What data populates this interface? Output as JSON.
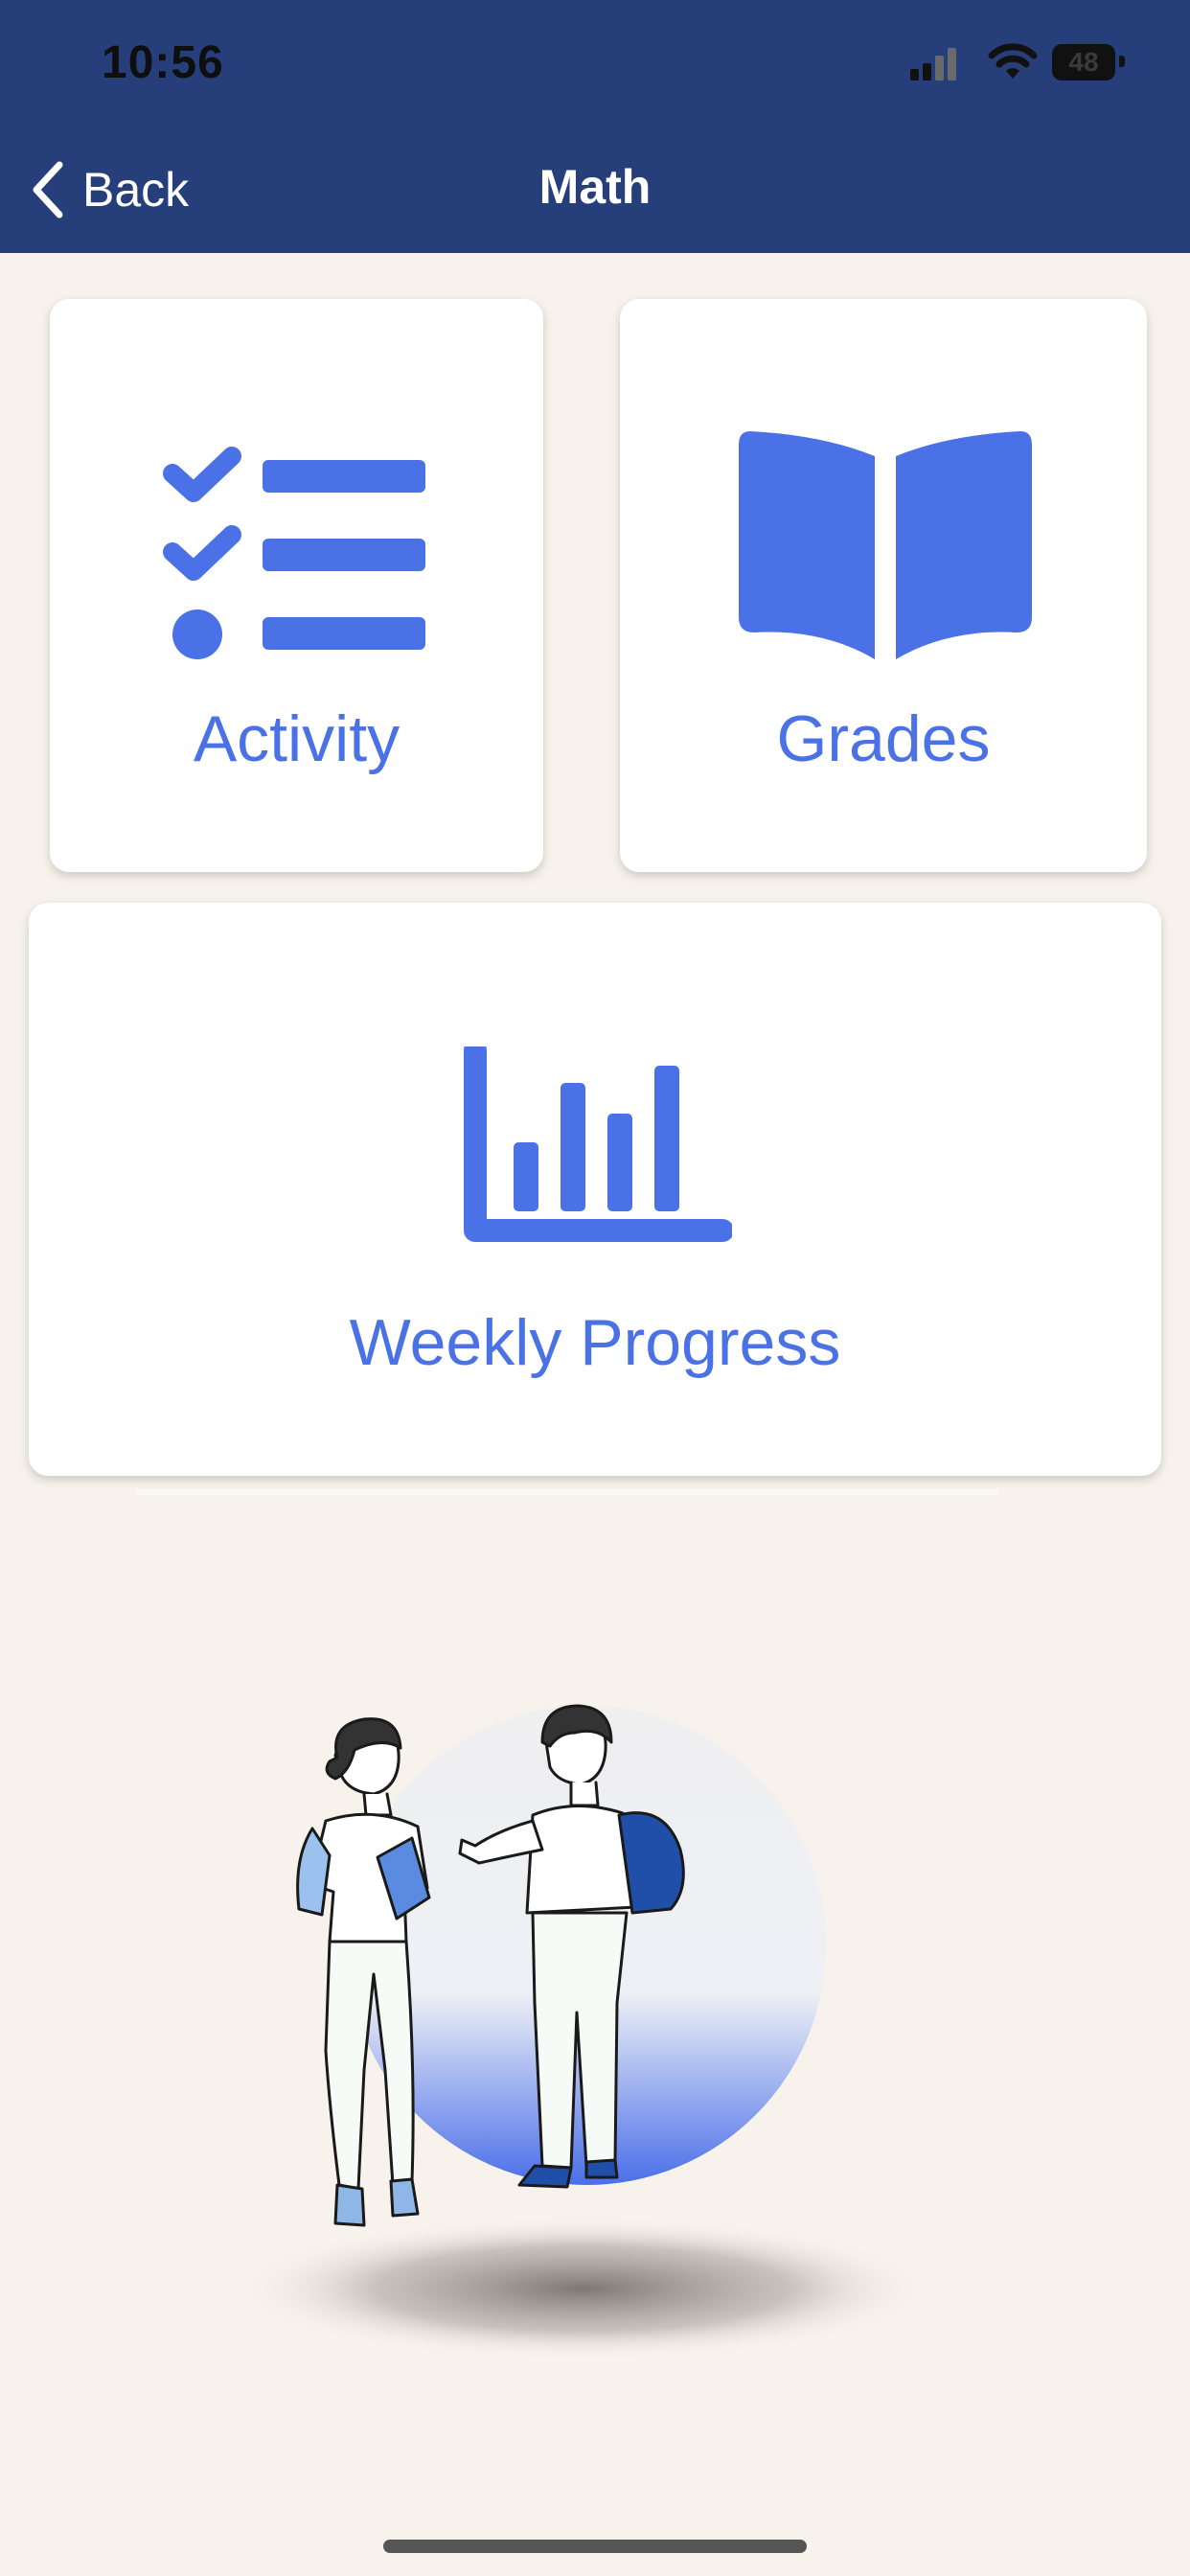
{
  "status_bar": {
    "time": "10:56",
    "battery_level": "48",
    "icons": [
      "cellular-signal-icon",
      "wifi-icon",
      "battery-icon"
    ]
  },
  "nav": {
    "back_label": "Back",
    "title": "Math"
  },
  "cards": {
    "activity": {
      "label": "Activity",
      "icon": "checklist-icon"
    },
    "grades": {
      "label": "Grades",
      "icon": "open-book-icon"
    },
    "weekly_progress": {
      "label": "Weekly Progress",
      "icon": "bar-chart-icon"
    }
  },
  "colors": {
    "header": "#263F7A",
    "accent": "#4A72E6",
    "background": "#F7F3EC",
    "card": "#FFFFFF"
  }
}
